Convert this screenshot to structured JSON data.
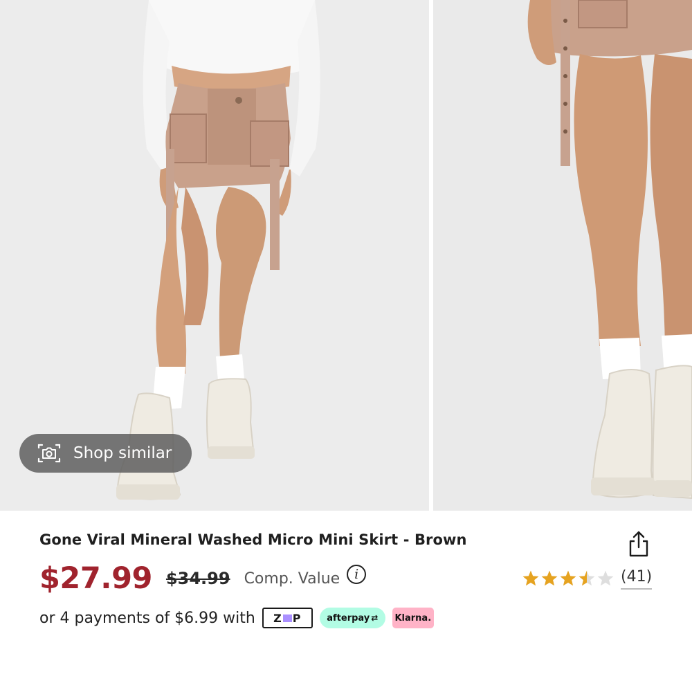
{
  "gallery": {
    "shop_similar_label": "Shop similar",
    "camera_icon": "camera-icon"
  },
  "product": {
    "title": "Gone Viral Mineral Washed Micro Mini Skirt - Brown",
    "price_current": "$27.99",
    "price_original": "$34.99",
    "comp_value_label": "Comp. Value",
    "info_icon": "info-icon",
    "share_icon": "share-icon",
    "rating_value": 3.5,
    "rating_max": 5,
    "review_count": "(41)",
    "payments_text": "or 4 payments of $6.99 with",
    "zip_label": "ZIP",
    "afterpay_label": "afterpay",
    "klarna_label": "Klarna."
  },
  "colors": {
    "price_accent": "#a0232d",
    "star_fill": "#e6a320",
    "star_empty": "#dedede",
    "afterpay_bg": "#b2fce4",
    "klarna_bg": "#ffb3c7",
    "zip_purple": "#aa8fff"
  }
}
